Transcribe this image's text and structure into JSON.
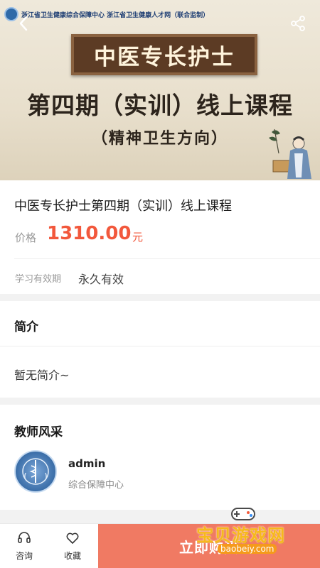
{
  "banner": {
    "org_line": "浙江省卫生健康综合保障中心  浙江省卫生健康人才网（联合监制）",
    "board_title": "中医专长护士",
    "line1": "第四期（实训）线上课程",
    "line2": "（精神卫生方向）",
    "back_icon": "chevron-left-icon",
    "share_icon": "share-icon"
  },
  "course": {
    "title": "中医专长护士第四期（实训）线上课程",
    "price_label": "价格",
    "price": "1310.00",
    "price_unit": "元",
    "validity_label": "学习有效期",
    "validity_value": "永久有效"
  },
  "intro": {
    "heading": "简介",
    "text": "暂无简介~"
  },
  "teachers": {
    "heading": "教师风采",
    "items": [
      {
        "name": "admin",
        "org": "综合保障中心"
      }
    ]
  },
  "bottom_bar": {
    "consult_label": "咨询",
    "favorite_label": "收藏",
    "buy_label": "立即购买"
  },
  "watermark": {
    "title": "宝贝游戏网",
    "url": "baobeiy.com"
  },
  "colors": {
    "accent": "#f2583c",
    "buy_button": "#f07a63"
  }
}
